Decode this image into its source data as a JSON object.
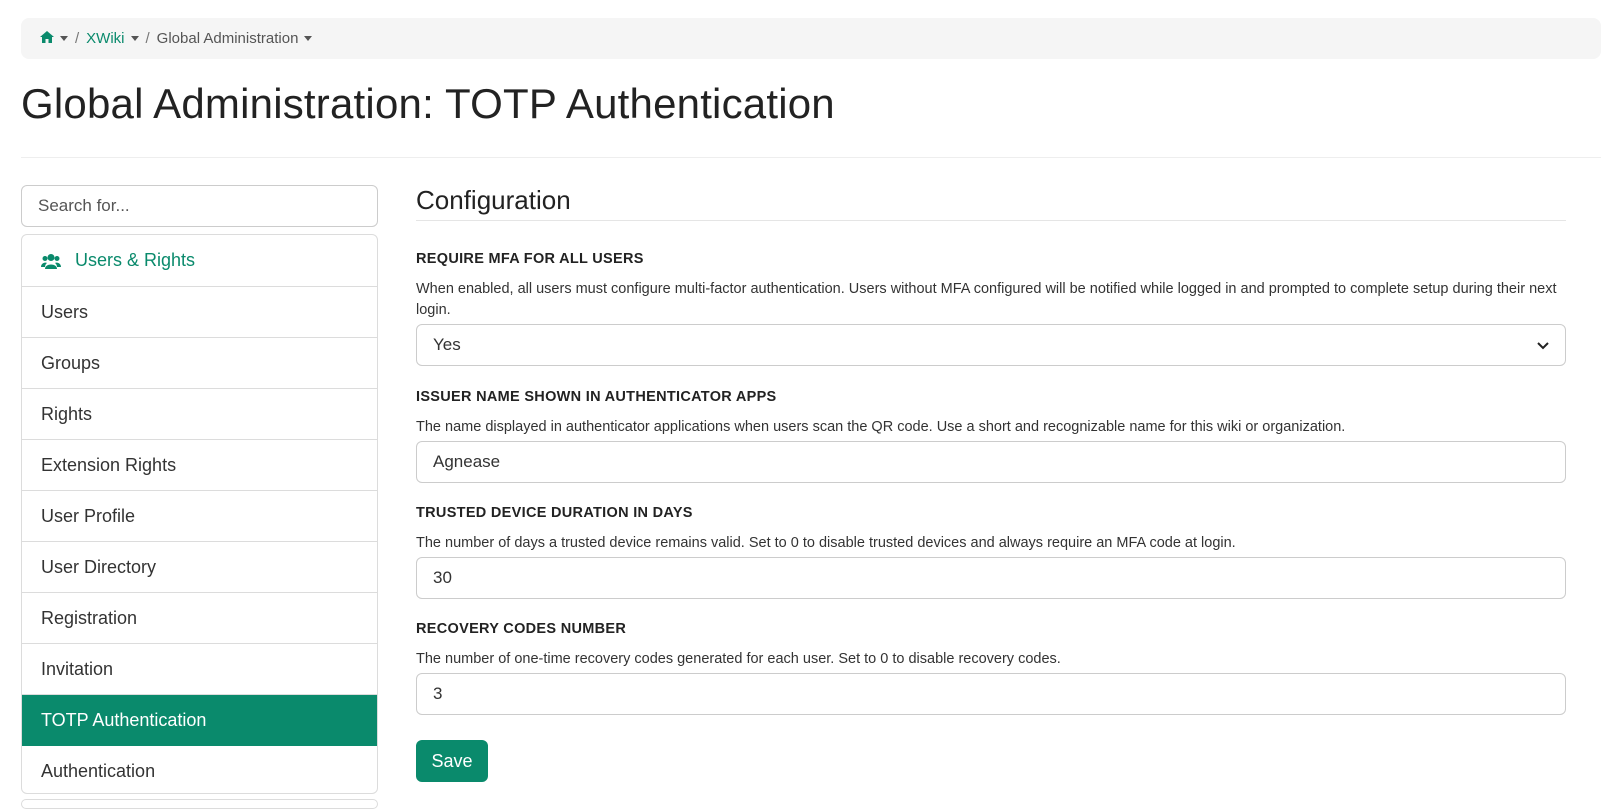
{
  "colors": {
    "accent": "#0a8a6c",
    "breadcrumb_bg": "#f5f5f5"
  },
  "breadcrumb": {
    "home_icon": "home-icon",
    "items": [
      "XWiki",
      "Global Administration"
    ],
    "separator": "/"
  },
  "page": {
    "title": "Global Administration: TOTP Authentication"
  },
  "sidebar": {
    "search_placeholder": "Search for...",
    "section": {
      "icon": "users-icon",
      "label": "Users & Rights"
    },
    "items": [
      {
        "label": "Users",
        "active": false
      },
      {
        "label": "Groups",
        "active": false
      },
      {
        "label": "Rights",
        "active": false
      },
      {
        "label": "Extension Rights",
        "active": false
      },
      {
        "label": "User Profile",
        "active": false
      },
      {
        "label": "User Directory",
        "active": false
      },
      {
        "label": "Registration",
        "active": false
      },
      {
        "label": "Invitation",
        "active": false
      },
      {
        "label": "TOTP Authentication",
        "active": true
      },
      {
        "label": "Authentication",
        "active": false
      }
    ]
  },
  "main": {
    "section_title": "Configuration",
    "fields": [
      {
        "label": "REQUIRE MFA FOR ALL USERS",
        "hint": "When enabled, all users must configure multi-factor authentication. Users without MFA configured will be notified while logged in and prompted to complete setup during their next login.",
        "type": "select",
        "value": "Yes"
      },
      {
        "label": "ISSUER NAME SHOWN IN AUTHENTICATOR APPS",
        "hint": "The name displayed in authenticator applications when users scan the QR code. Use a short and recognizable name for this wiki or organization.",
        "type": "text",
        "value": "Agnease"
      },
      {
        "label": "TRUSTED DEVICE DURATION IN DAYS",
        "hint": "The number of days a trusted device remains valid. Set to 0 to disable trusted devices and always require an MFA code at login.",
        "type": "number",
        "value": "30"
      },
      {
        "label": "RECOVERY CODES NUMBER",
        "hint": "The number of one-time recovery codes generated for each user. Set to 0 to disable recovery codes.",
        "type": "number",
        "value": "3"
      }
    ],
    "save_label": "Save"
  }
}
